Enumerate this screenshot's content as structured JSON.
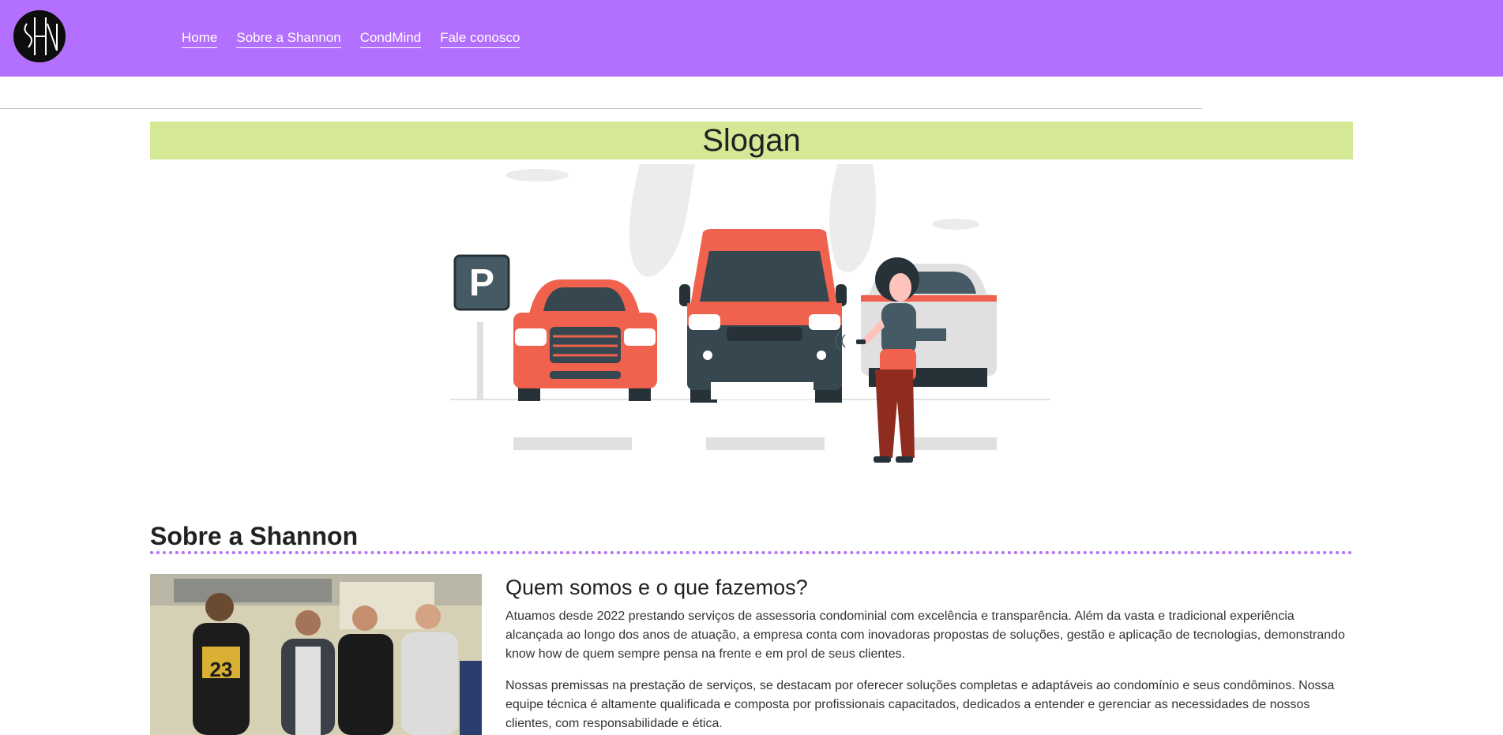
{
  "nav": {
    "logo_alt": "SHN",
    "links": [
      "Home",
      "Sobre a Shannon",
      "CondMind",
      "Fale conosco"
    ]
  },
  "hero": {
    "slogan": "Slogan",
    "illustration": "parking-lot-illustration",
    "parking_sign": "P"
  },
  "about": {
    "heading": "Sobre a Shannon",
    "subheading": "Quem somos e o que fazemos?",
    "paragraphs": [
      "Atuamos desde 2022 prestando serviços de assessoria condominial com excelência e transparência. Além da vasta e tradicional experiência alcançada ao longo dos anos de atuação, a empresa conta com inovadoras propostas de soluções, gestão e aplicação de tecnologias, demonstrando know how de quem sempre pensa na frente e em prol de seus clientes.",
      "Nossas premissas na prestação de serviços, se destacam por oferecer soluções completas e adaptáveis ao condomínio e seus condôminos. Nossa equipe técnica é altamente qualificada e composta por profissionais capacitados, dedicados a entender e gerenciar as necessidades de nossos clientes, com responsabilidade e ética."
    ],
    "photo": "team-photo"
  },
  "colors": {
    "navbar": "#b36ffd",
    "slogan_bar": "#d4e896",
    "accent_red": "#f0624d",
    "dark_teal": "#263238"
  }
}
